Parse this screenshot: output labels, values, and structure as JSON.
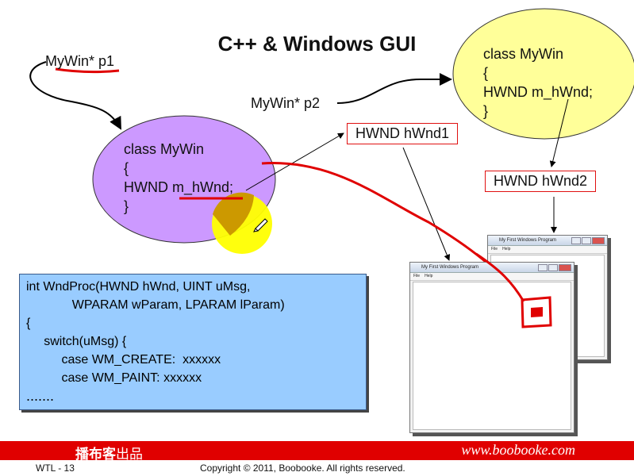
{
  "title": "C++ & Windows GUI",
  "labels": {
    "p1": "MyWin* p1",
    "p2": "MyWin* p2",
    "hwnd1": "HWND hWnd1",
    "hwnd2": "HWND hWnd2"
  },
  "purple_class": [
    "class MyWin",
    "{",
    "HWND m_hWnd;",
    "}"
  ],
  "yellow_class": [
    "class MyWin",
    "{",
    "HWND m_hWnd;",
    "}"
  ],
  "code": [
    "int WndProc(HWND hWnd, UINT uMsg,",
    "             WPARAM wParam, LPARAM lParam)",
    "{",
    "     switch(uMsg) {",
    "          case WM_CREATE:  xxxxxx",
    "          case WM_PAINT: xxxxxx",
    "......."
  ],
  "windows": {
    "title": "My First Windows Program",
    "menu_file": "File",
    "menu_help": "Help"
  },
  "footer": {
    "brand": "播布客",
    "brand_suffix": "出品",
    "url": "www.boobooke.com",
    "slide_no": "WTL - 13",
    "copyright": "Copyright © 2011, Boobooke. All rights reserved."
  },
  "colors": {
    "purple_ellipse": "#cc99ff",
    "yellow_ellipse": "#ffff99",
    "yellow_spot": "#ffff00",
    "code_bg": "#99ccff",
    "footer_red": "#e00000",
    "annotation_red": "#e00000"
  }
}
